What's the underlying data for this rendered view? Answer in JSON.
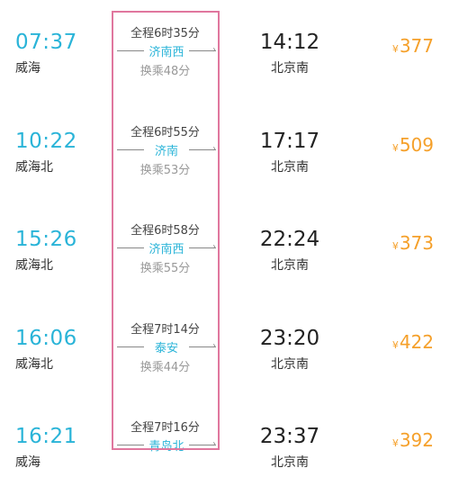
{
  "colors": {
    "accent": "#2ab4d8",
    "price": "#f5a02a",
    "highlight_box": "#e0779e"
  },
  "currency_symbol": "¥",
  "trains": [
    {
      "dep_time": "07:37",
      "dep_station": "威海",
      "duration": "全程6时35分",
      "transfer_station": "济南西",
      "transfer_wait": "换乘48分",
      "arr_time": "14:12",
      "arr_station": "北京南",
      "price": "377"
    },
    {
      "dep_time": "10:22",
      "dep_station": "威海北",
      "duration": "全程6时55分",
      "transfer_station": "济南",
      "transfer_wait": "换乘53分",
      "arr_time": "17:17",
      "arr_station": "北京南",
      "price": "509"
    },
    {
      "dep_time": "15:26",
      "dep_station": "威海北",
      "duration": "全程6时58分",
      "transfer_station": "济南西",
      "transfer_wait": "换乘55分",
      "arr_time": "22:24",
      "arr_station": "北京南",
      "price": "373"
    },
    {
      "dep_time": "16:06",
      "dep_station": "威海北",
      "duration": "全程7时14分",
      "transfer_station": "泰安",
      "transfer_wait": "换乘44分",
      "arr_time": "23:20",
      "arr_station": "北京南",
      "price": "422"
    },
    {
      "dep_time": "16:21",
      "dep_station": "威海",
      "duration": "全程7时16分",
      "transfer_station": "青岛北",
      "transfer_wait": "",
      "arr_time": "23:37",
      "arr_station": "北京南",
      "price": "392"
    }
  ]
}
